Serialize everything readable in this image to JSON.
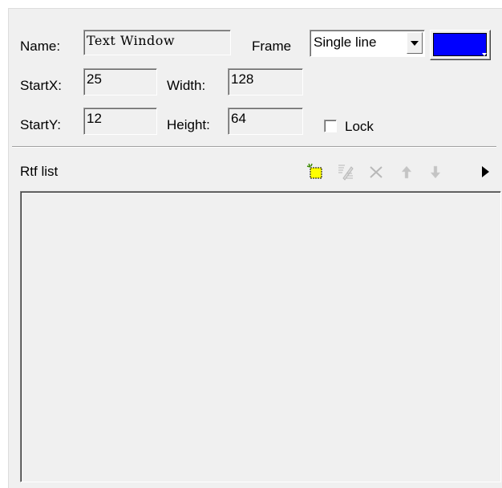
{
  "form": {
    "name_label": "Name:",
    "name_value": "Text Window",
    "frame_label": "Frame",
    "frame_value": "Single line",
    "frame_color": "#0000ff",
    "startx_label": "StartX:",
    "startx_value": "25",
    "width_label": "Width:",
    "width_value": "128",
    "starty_label": "StartY:",
    "starty_value": "12",
    "height_label": "Height:",
    "height_value": "64",
    "lock_label": "Lock",
    "lock_checked": false
  },
  "rtf": {
    "label": "Rtf list",
    "toolbar": [
      {
        "icon": "new-item-icon",
        "enabled": true
      },
      {
        "icon": "edit-item-icon",
        "enabled": false
      },
      {
        "icon": "delete-icon",
        "enabled": false
      },
      {
        "icon": "move-up-icon",
        "enabled": false
      },
      {
        "icon": "move-down-icon",
        "enabled": false
      },
      {
        "icon": "play-icon",
        "enabled": true
      }
    ],
    "items": []
  }
}
